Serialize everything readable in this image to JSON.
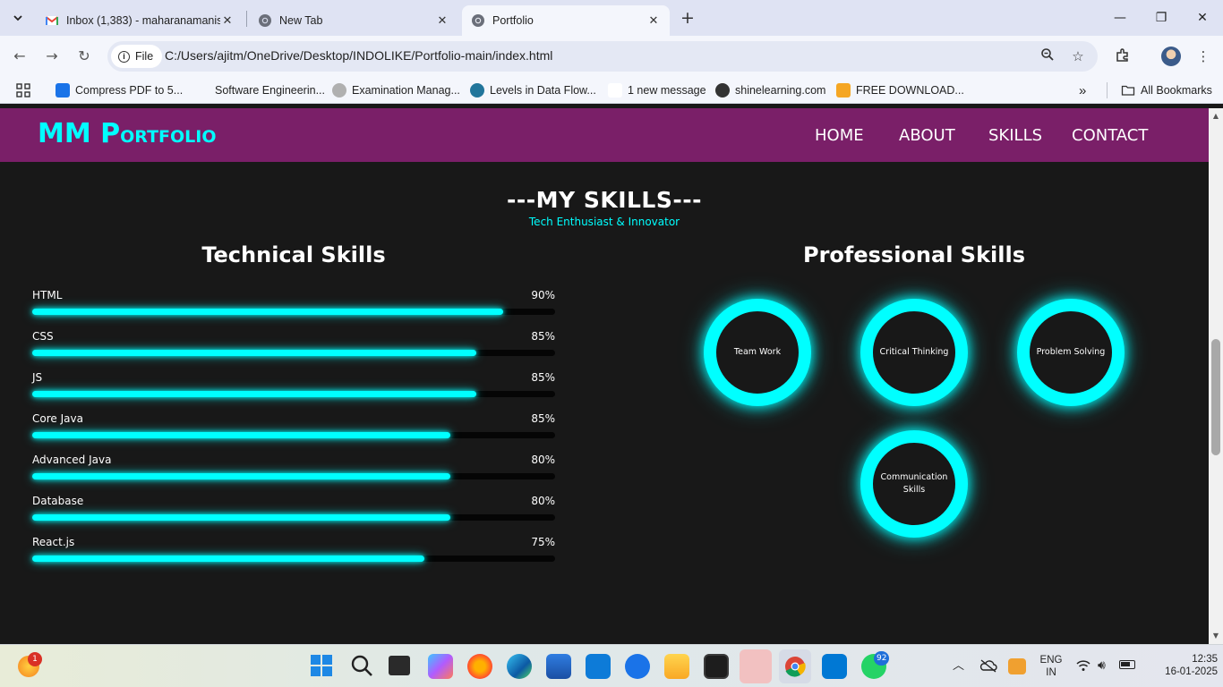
{
  "browser": {
    "tabs": [
      {
        "title": "Inbox (1,383) - maharanamanis"
      },
      {
        "title": "New Tab"
      },
      {
        "title": "Portfolio"
      }
    ],
    "address": {
      "scheme_label": "File",
      "url": "C:/Users/ajitm/OneDrive/Desktop/INDOLIKE/Portfolio-main/index.html"
    },
    "bookmarks": [
      {
        "label": "Compress PDF to 5..."
      },
      {
        "label": "Software Engineerin..."
      },
      {
        "label": "Examination Manag..."
      },
      {
        "label": "Levels in Data Flow..."
      },
      {
        "label": "1 new message"
      },
      {
        "label": "shinelearning.com"
      },
      {
        "label": "FREE DOWNLOAD..."
      }
    ],
    "all_bookmarks": "All Bookmarks",
    "overflow": "»"
  },
  "site": {
    "logo": {
      "initials": "MM P",
      "rest": "ORTFOLIO"
    },
    "nav": [
      "HOME",
      "ABOUT",
      "SKILLS",
      "CONTACT"
    ],
    "section_title": "---MY SKILLS---",
    "section_subtitle": "Tech Enthusiast & Innovator",
    "technical_title": "Technical Skills",
    "professional_title": "Professional Skills",
    "technical_skills": [
      {
        "name": "HTML",
        "percent_label": "90%",
        "percent": 90
      },
      {
        "name": "CSS",
        "percent_label": "85%",
        "percent": 85
      },
      {
        "name": "JS",
        "percent_label": "85%",
        "percent": 85
      },
      {
        "name": "Core Java",
        "percent_label": "85%",
        "percent": 80
      },
      {
        "name": "Advanced Java",
        "percent_label": "80%",
        "percent": 80
      },
      {
        "name": "Database",
        "percent_label": "80%",
        "percent": 80
      },
      {
        "name": "React.js",
        "percent_label": "75%",
        "percent": 75
      }
    ],
    "professional_skills": [
      "Team Work",
      "Critical Thinking",
      "Problem Solving",
      "Communication Skills"
    ]
  },
  "taskbar": {
    "notification_count": "1",
    "whatsapp_badge": "92",
    "language": "ENG",
    "region": "IN",
    "time": "12:35",
    "date": "16-01-2025"
  },
  "colors": {
    "accent": "#00ffff",
    "header": "#7a1f68",
    "background": "#181818"
  }
}
